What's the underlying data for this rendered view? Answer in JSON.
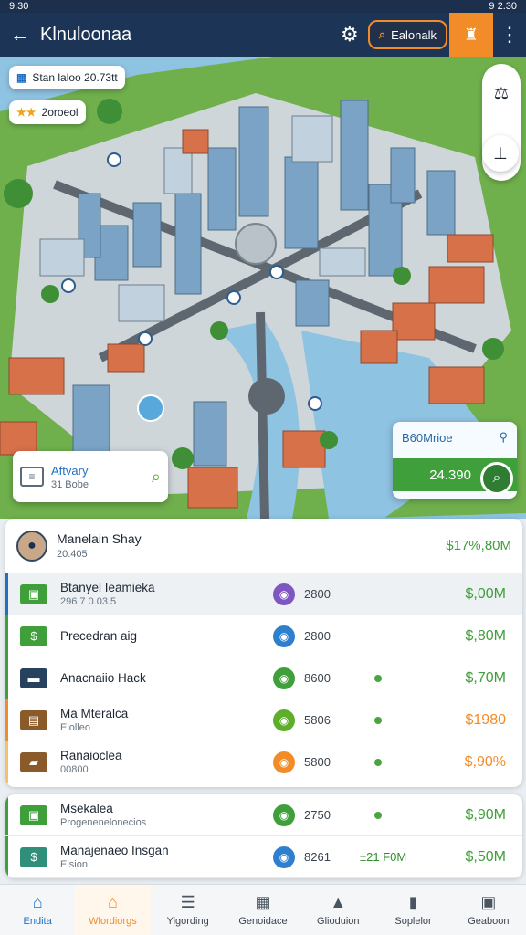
{
  "status_bar": {
    "time": "9.30",
    "right": "9 2.30"
  },
  "app_bar": {
    "title": "Klnuloonaa",
    "pill_label": "Ealonalk"
  },
  "map": {
    "chip_top": {
      "text": "Stan laloo 20.73tt"
    },
    "chip_second": {
      "text": "2oroeol"
    },
    "info_card": {
      "title": "Aftvary",
      "subtitle": "31 Bobe"
    },
    "value_card": {
      "title": "B60Mrioe",
      "amount": "24.390"
    }
  },
  "panel": {
    "header": {
      "name": "Manelain Shay",
      "sub": "20.405",
      "amount": "$17%,80M"
    },
    "rows": [
      {
        "label": "Btanyel Ieamieka",
        "sub": "296 7 0.03.5",
        "number": "2800",
        "mid": "",
        "value": "$,00M",
        "bar_color": "#1f6fc4",
        "icon_color": "#3f9f3a",
        "circle_color": "#7e57c2",
        "value_color": "#3f9f3a"
      },
      {
        "label": "Precedran aig",
        "sub": "",
        "number": "2800",
        "mid": "",
        "value": "$,80M",
        "bar_color": "#3f9f3a",
        "icon_color": "#3f9f3a",
        "circle_color": "#2f7fcf",
        "value_color": "#3f9f3a"
      },
      {
        "label": "Anacnaiio Hack",
        "sub": "",
        "number": "8600",
        "mid": "",
        "value": "$,70M",
        "bar_color": "#3f9f3a",
        "icon_color": "#27425f",
        "circle_color": "#3f9f3a",
        "value_color": "#3f9f3a"
      },
      {
        "label": "Ma Mteralca",
        "sub": "Elolleo",
        "number": "5806",
        "mid": "",
        "value": "$1980",
        "bar_color": "#f28c28",
        "icon_color": "#8a5a2b",
        "circle_color": "#5fae2b",
        "value_color": "#f28c28"
      },
      {
        "label": "Ranaioclea",
        "sub": "00800",
        "number": "5800",
        "mid": "",
        "value": "$,90%",
        "bar_color": "#f0c26a",
        "icon_color": "#8a5a2b",
        "circle_color": "#f28c28",
        "value_color": "#f28c28"
      }
    ]
  },
  "panel2": {
    "rows": [
      {
        "label": "Msekalea",
        "sub": "Progenenelonecios",
        "number": "2750",
        "mid": "",
        "value": "$,90M",
        "bar_color": "#3f9f3a",
        "icon_color": "#3f9f3a",
        "circle_color": "#3f9f3a",
        "value_color": "#3f9f3a"
      },
      {
        "label": "Manajenaeo Insgan",
        "sub": "Elsion",
        "number": "8261",
        "mid": "±21 F0M",
        "value": "$,50M",
        "bar_color": "#3f9f3a",
        "icon_color": "#2f8f7a",
        "circle_color": "#2f7fcf",
        "value_color": "#3f9f3a"
      }
    ]
  },
  "bottom_nav": [
    {
      "label": "Endita",
      "icon": "home-icon"
    },
    {
      "label": "Wlordiorgs",
      "icon": "building-icon"
    },
    {
      "label": "Yigording",
      "icon": "list-icon"
    },
    {
      "label": "Genoidace",
      "icon": "map-icon"
    },
    {
      "label": "Glioduion",
      "icon": "warning-icon"
    },
    {
      "label": "Soplelor",
      "icon": "book-icon"
    },
    {
      "label": "Geaboon",
      "icon": "calendar-icon"
    }
  ]
}
